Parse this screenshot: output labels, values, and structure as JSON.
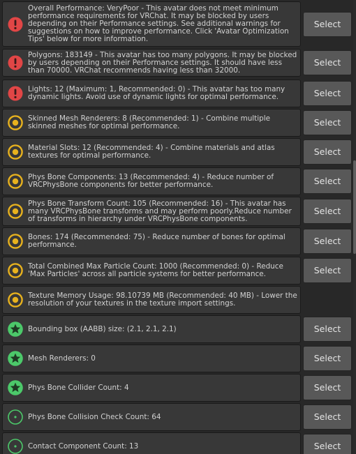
{
  "colors": {
    "error": "#e14646",
    "warning": "#e8b21e",
    "good": "#4cc96a",
    "panel": "#383838",
    "button": "#585858"
  },
  "select_label": "Select",
  "items": [
    {
      "level": "error",
      "icon": "error-icon",
      "has_button": true,
      "text": "Overall Performance: VeryPoor - This avatar does not meet minimum performance requirements for VRChat. It may be blocked by users depending on their Performance settings. See additional warnings for suggestions on how to improve performance. Click 'Avatar Optimization Tips' below for more information."
    },
    {
      "level": "error",
      "icon": "error-icon",
      "has_button": true,
      "text": "Polygons: 183149 - This avatar has too many polygons. It may be blocked by users depending on their Performance settings. It should have less than 70000. VRChat recommends having less than 32000."
    },
    {
      "level": "error",
      "icon": "error-icon",
      "has_button": true,
      "text": "Lights: 12 (Maximum: 1, Recommended: 0) - This avatar has too many dynamic lights. Avoid use of dynamic lights for optimal performance."
    },
    {
      "level": "warning",
      "icon": "warning-circle-icon",
      "has_button": true,
      "text": "Skinned Mesh Renderers: 8 (Recommended: 1) - Combine multiple skinned meshes for optimal performance."
    },
    {
      "level": "warning",
      "icon": "warning-circle-icon",
      "has_button": true,
      "text": "Material Slots: 12 (Recommended: 4) - Combine materials and atlas textures for optimal performance."
    },
    {
      "level": "warning",
      "icon": "warning-circle-icon",
      "has_button": true,
      "text": "Phys Bone Components: 13 (Recommended: 4) - Reduce number of VRCPhysBone components for better performance."
    },
    {
      "level": "warning",
      "icon": "warning-circle-icon",
      "has_button": true,
      "text": "Phys Bone Transform Count: 105 (Recommended: 16) - This avatar has many VRCPhysBone transforms and may perform poorly.Reduce number of transforms in hierarchy under VRCPhysBone components."
    },
    {
      "level": "warning",
      "icon": "warning-circle-icon",
      "has_button": true,
      "text": "Bones: 174 (Recommended: 75) - Reduce number of bones for optimal performance."
    },
    {
      "level": "warning",
      "icon": "warning-circle-icon",
      "has_button": true,
      "text": "Total Combined Max Particle Count: 1000 (Recommended: 0) - Reduce 'Max Particles' across all particle systems for better performance."
    },
    {
      "level": "warning",
      "icon": "warning-circle-icon",
      "has_button": false,
      "text": "Texture Memory Usage: 98.10739 MB (Recommended: 40 MB) - Lower the resolution of your textures in the texture import settings."
    },
    {
      "level": "excellent",
      "icon": "star-icon",
      "has_button": true,
      "text": "Bounding box (AABB) size: (2.1, 2.1, 2.1)"
    },
    {
      "level": "excellent",
      "icon": "star-icon",
      "has_button": true,
      "text": "Mesh Renderers: 0"
    },
    {
      "level": "excellent",
      "icon": "star-icon",
      "has_button": true,
      "text": "Phys Bone Collider Count: 4"
    },
    {
      "level": "good",
      "icon": "dot-circle-icon",
      "has_button": true,
      "text": "Phys Bone Collision Check Count: 64"
    },
    {
      "level": "good",
      "icon": "dot-circle-icon",
      "has_button": true,
      "text": "Contact Component Count: 13"
    }
  ]
}
